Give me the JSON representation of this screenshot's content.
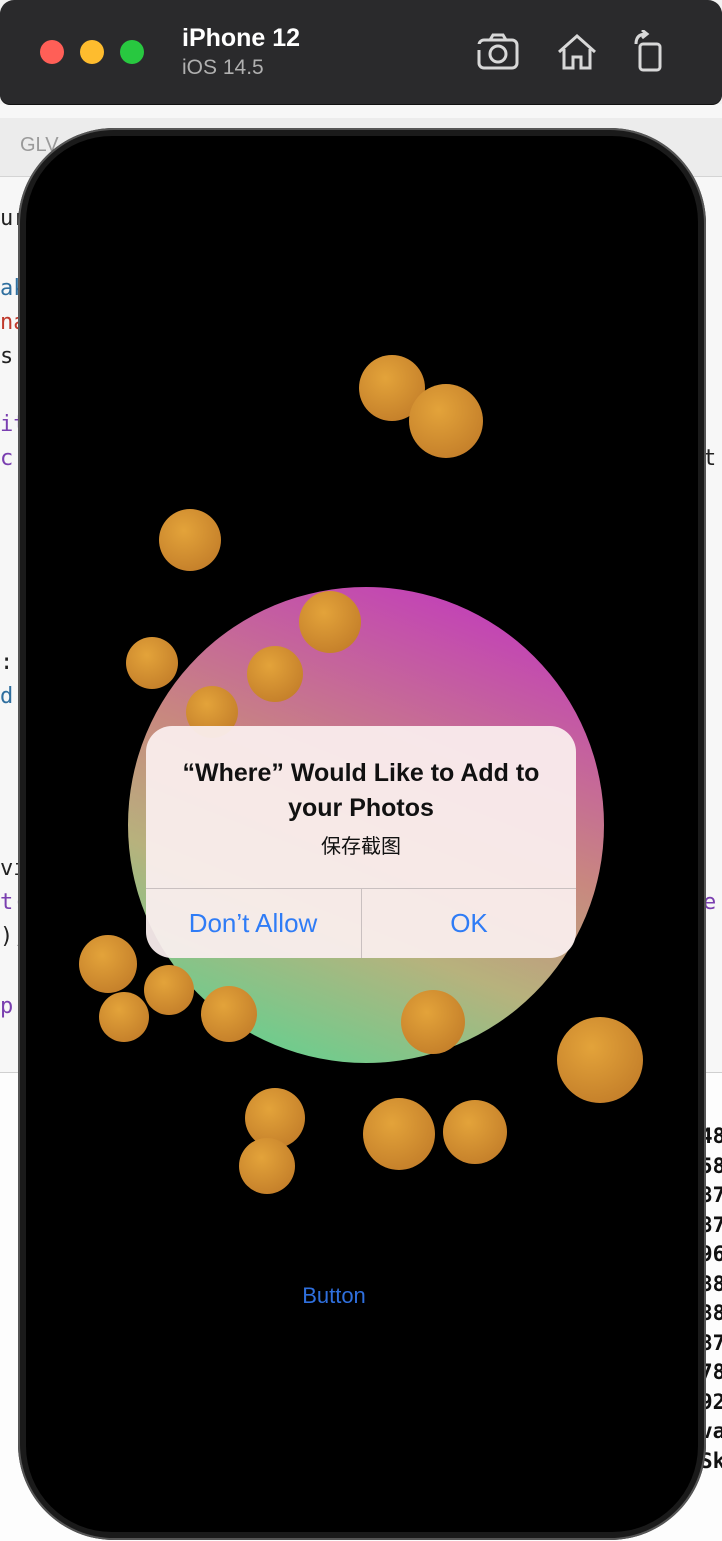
{
  "simulator": {
    "device_name": "iPhone 12",
    "os_version": "iOS 14.5",
    "icons": [
      "screenshot-icon",
      "home-icon",
      "rotate-icon"
    ]
  },
  "background_editor": {
    "tab_label": "GLV",
    "left_fragments": [
      "ur",
      "ak",
      "na",
      "s",
      "it",
      "c",
      ":",
      "d",
      "vi",
      "t(",
      ");",
      "p"
    ],
    "right_fragments": [
      "t",
      "e"
    ],
    "console_lines": [
      "48",
      "58",
      "87",
      "87",
      "96",
      "88",
      "88",
      "87",
      "78",
      "92",
      "va",
      "Sk"
    ]
  },
  "alert": {
    "title": "“Where” Would Like to Add to your Photos",
    "message": "保存截图",
    "buttons": {
      "deny": "Don’t Allow",
      "ok": "OK"
    },
    "accent_color": "#2f7cf6"
  },
  "app": {
    "button_label": "Button"
  },
  "colors": {
    "ball": "#d9932e",
    "sphere_top": "#c042b8",
    "sphere_bottom": "#7fd08a"
  }
}
